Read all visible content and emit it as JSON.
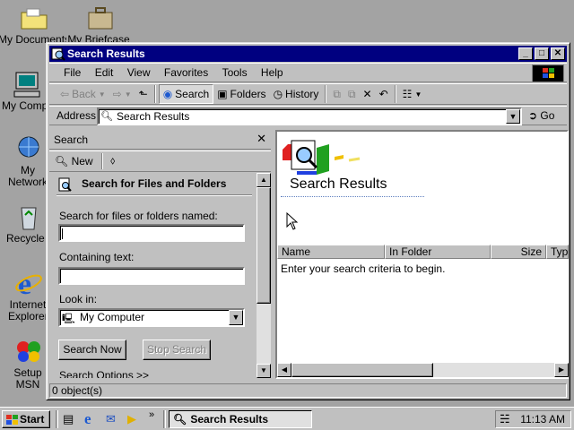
{
  "desktop": {
    "icons": [
      {
        "label": "My Documents"
      },
      {
        "label": "My Briefcase"
      },
      {
        "label": "My Computer"
      },
      {
        "label": "My Network Places"
      },
      {
        "label": "Recycle Bin"
      },
      {
        "label": "Internet Explorer"
      },
      {
        "label": "Setup MSN Internet Access"
      }
    ]
  },
  "window": {
    "title": "Search Results",
    "menu": [
      "File",
      "Edit",
      "View",
      "Favorites",
      "Tools",
      "Help"
    ],
    "toolbar": {
      "back": "Back",
      "search": "Search",
      "folders": "Folders",
      "history": "History"
    },
    "address": {
      "label": "Address",
      "value": "Search Results",
      "go": "Go"
    },
    "search_pane": {
      "title": "Search",
      "new": "New",
      "heading": "Search for Files and Folders",
      "name_label": "Search for files or folders named:",
      "name_value": "",
      "containing_label": "Containing text:",
      "containing_value": "",
      "look_in_label": "Look in:",
      "look_in_value": "My Computer",
      "search_now": "Search Now",
      "stop_search": "Stop Search",
      "options": "Search Options >>"
    },
    "results": {
      "title": "Search Results",
      "columns": [
        "Name",
        "In Folder",
        "Size",
        "Type"
      ],
      "message": "Enter your search criteria to begin."
    },
    "status": "0 object(s)"
  },
  "taskbar": {
    "start": "Start",
    "task": "Search Results",
    "clock": "11:13 AM"
  },
  "colors": {
    "titlebar": "#000080",
    "desktop": "#a3a3a3",
    "face": "#c0c0c0"
  }
}
